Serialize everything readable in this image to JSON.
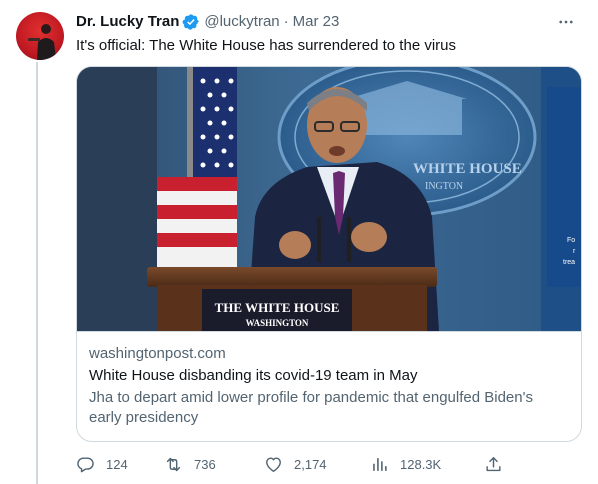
{
  "tweet": {
    "display_name": "Dr. Lucky Tran",
    "handle": "@luckytran",
    "separator": "·",
    "date": "Mar 23",
    "text": "It's official: The White House has surrendered to the virus"
  },
  "card": {
    "image_podium_sign_line1": "THE WHITE HOUSE",
    "image_podium_sign_line2": "WASHINGTON",
    "image_backdrop_line1": "WHITE HOUSE",
    "image_backdrop_line2": "INGTON",
    "domain": "washingtonpost.com",
    "title": "White House disbanding its covid-19 team in May",
    "description": "Jha to depart amid lower profile for pandemic that engulfed Biden's early presidency"
  },
  "actions": {
    "replies": "124",
    "retweets": "736",
    "likes": "2,174",
    "views": "128.3K"
  },
  "icons": {
    "verified": "verified-badge-icon",
    "more": "more-icon",
    "reply": "reply-icon",
    "retweet": "retweet-icon",
    "like": "heart-icon",
    "views": "views-icon",
    "share": "share-icon"
  },
  "colors": {
    "verified_blue": "#1d9bf0",
    "text_primary": "#0f1419",
    "text_secondary": "#536471",
    "border": "#cfd9de",
    "avatar_red": "#d0202a"
  }
}
